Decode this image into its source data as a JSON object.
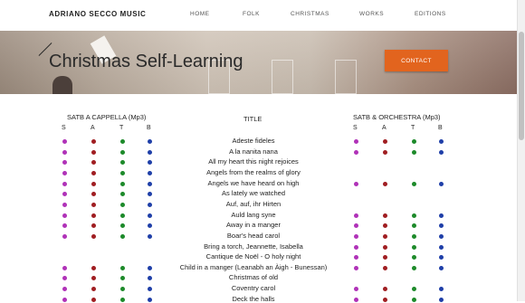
{
  "brand": "ADRIANO SECCO MUSIC",
  "nav": [
    "HOME",
    "FOLK",
    "CHRISTMAS",
    "WORKS",
    "EDITIONS"
  ],
  "hero_title": "Christmas Self-Learning",
  "contact_label": "CONTACT",
  "headers": {
    "left": "SATB A CAPPELLA (Mp3)",
    "center": "TITLE",
    "right": "SATB & ORCHESTRA (Mp3)"
  },
  "voices": [
    "S",
    "A",
    "T",
    "B"
  ],
  "colors": {
    "S": "#b032b8",
    "A": "#a01e22",
    "T": "#1d8a2a",
    "B": "#1f3fa8",
    "accent": "#e2641e"
  },
  "songs": [
    {
      "title": "Adeste fideles",
      "cappella": [
        true,
        true,
        true,
        true
      ],
      "orchestra": [
        true,
        true,
        true,
        true
      ]
    },
    {
      "title": "A la nanita nana",
      "cappella": [
        true,
        true,
        true,
        true
      ],
      "orchestra": [
        true,
        true,
        true,
        true
      ]
    },
    {
      "title": "All my heart this night rejoices",
      "cappella": [
        true,
        true,
        true,
        true
      ],
      "orchestra": [
        false,
        false,
        false,
        false
      ]
    },
    {
      "title": "Angels from the realms of glory",
      "cappella": [
        true,
        true,
        true,
        true
      ],
      "orchestra": [
        false,
        false,
        false,
        false
      ]
    },
    {
      "title": "Angels we have heard on high",
      "cappella": [
        true,
        true,
        true,
        true
      ],
      "orchestra": [
        true,
        true,
        true,
        true
      ]
    },
    {
      "title": "As lately we watched",
      "cappella": [
        true,
        true,
        true,
        true
      ],
      "orchestra": [
        false,
        false,
        false,
        false
      ]
    },
    {
      "title": "Auf, auf, ihr Hirten",
      "cappella": [
        true,
        true,
        true,
        true
      ],
      "orchestra": [
        false,
        false,
        false,
        false
      ]
    },
    {
      "title": "Auld lang syne",
      "cappella": [
        true,
        true,
        true,
        true
      ],
      "orchestra": [
        true,
        true,
        true,
        true
      ]
    },
    {
      "title": "Away in a manger",
      "cappella": [
        true,
        true,
        true,
        true
      ],
      "orchestra": [
        true,
        true,
        true,
        true
      ]
    },
    {
      "title": "Boar's head carol",
      "cappella": [
        true,
        true,
        true,
        true
      ],
      "orchestra": [
        true,
        true,
        true,
        true
      ]
    },
    {
      "title": "Bring a torch, Jeannette, Isabella",
      "cappella": [
        false,
        false,
        false,
        false
      ],
      "orchestra": [
        true,
        true,
        true,
        true
      ]
    },
    {
      "title": "Cantique de Noël - O holy night",
      "cappella": [
        false,
        false,
        false,
        false
      ],
      "orchestra": [
        true,
        true,
        true,
        true
      ]
    },
    {
      "title": "Child in a manger (Leanabh an Àigh - Bunessan)",
      "cappella": [
        true,
        true,
        true,
        true
      ],
      "orchestra": [
        true,
        true,
        true,
        true
      ]
    },
    {
      "title": "Christmas of old",
      "cappella": [
        true,
        true,
        true,
        true
      ],
      "orchestra": [
        false,
        false,
        false,
        false
      ]
    },
    {
      "title": "Coventry carol",
      "cappella": [
        true,
        true,
        true,
        true
      ],
      "orchestra": [
        true,
        true,
        true,
        true
      ]
    },
    {
      "title": "Deck the halls",
      "cappella": [
        true,
        true,
        true,
        true
      ],
      "orchestra": [
        true,
        true,
        true,
        true
      ]
    }
  ]
}
